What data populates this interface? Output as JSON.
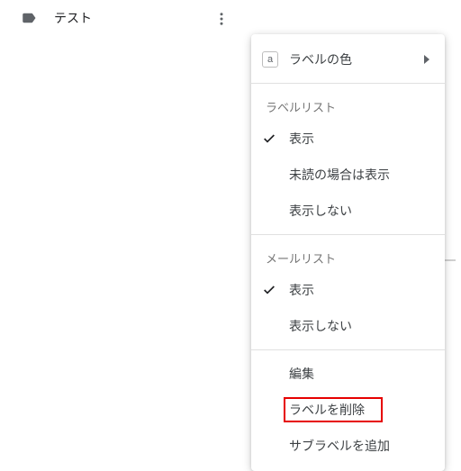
{
  "sidebar": {
    "label_name": "テスト"
  },
  "menu": {
    "color_badge_letter": "a",
    "color_label": "ラベルの色",
    "section_label_list": "ラベルリスト",
    "label_list": {
      "show": "表示",
      "show_if_unread": "未読の場合は表示",
      "hide": "表示しない"
    },
    "section_mail_list": "メールリスト",
    "mail_list": {
      "show": "表示",
      "hide": "表示しない"
    },
    "edit": "編集",
    "delete": "ラベルを削除",
    "add_sublabel": "サブラベルを追加"
  }
}
